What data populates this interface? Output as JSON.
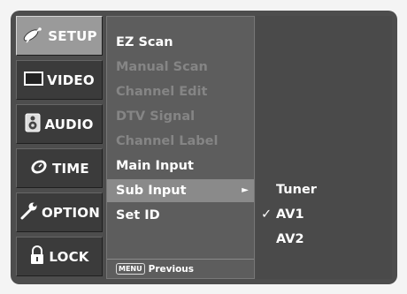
{
  "nav": [
    {
      "label": "SETUP",
      "icon": "satellite-dish-icon",
      "active": true
    },
    {
      "label": "VIDEO",
      "icon": "screen-icon",
      "active": false
    },
    {
      "label": "AUDIO",
      "icon": "speaker-icon",
      "active": false
    },
    {
      "label": "TIME",
      "icon": "clock-icon",
      "active": false
    },
    {
      "label": "OPTION",
      "icon": "wrench-icon",
      "active": false
    },
    {
      "label": "LOCK",
      "icon": "padlock-icon",
      "active": false
    }
  ],
  "menu": {
    "items": [
      {
        "label": "EZ Scan",
        "state": "enabled"
      },
      {
        "label": "Manual Scan",
        "state": "disabled"
      },
      {
        "label": "Channel Edit",
        "state": "disabled"
      },
      {
        "label": "DTV Signal",
        "state": "disabled"
      },
      {
        "label": "Channel Label",
        "state": "disabled"
      },
      {
        "label": "Main Input",
        "state": "enabled"
      },
      {
        "label": "Sub Input",
        "state": "selected",
        "arrow": "►"
      },
      {
        "label": "Set ID",
        "state": "enabled"
      }
    ],
    "footer": {
      "key_label": "MENU",
      "text": "Previous"
    }
  },
  "submenu": {
    "items": [
      {
        "label": "Tuner",
        "checked": false
      },
      {
        "label": "AV1",
        "checked": true,
        "check_mark": "✓"
      },
      {
        "label": "AV2",
        "checked": false
      }
    ]
  },
  "colors": {
    "frame": "#4d4d4d",
    "nav_button": "#3b3b3b",
    "nav_active": "#9a9a9a",
    "menu_panel": "#5d5d5d",
    "menu_selected": "#8a8a8a",
    "disabled_text": "#858585"
  }
}
